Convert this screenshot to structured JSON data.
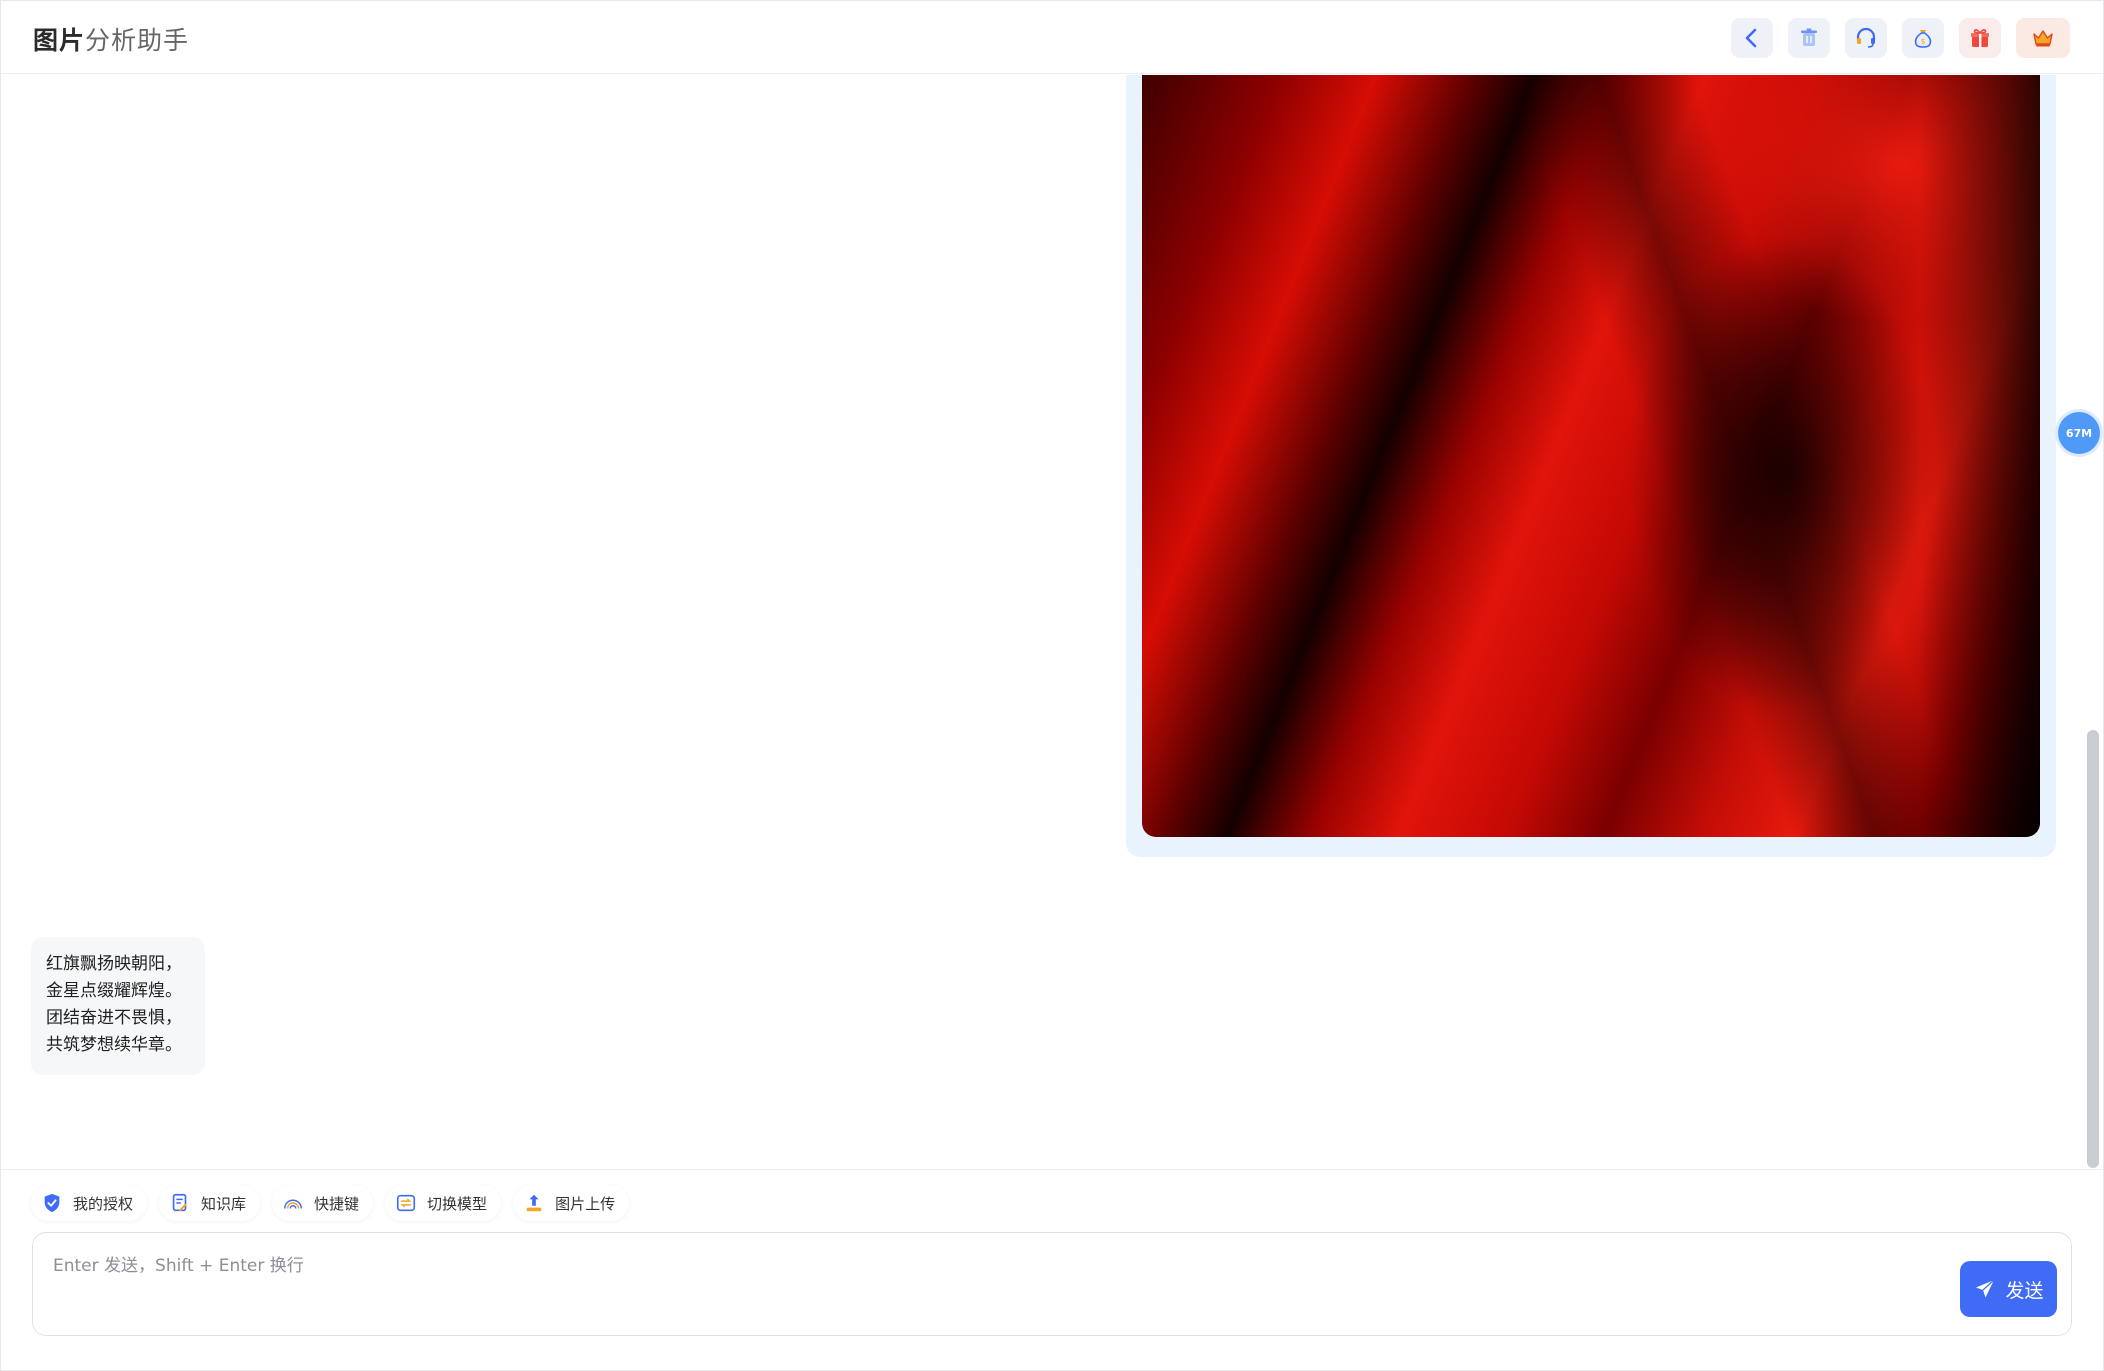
{
  "app": {
    "title_part1": "图片",
    "title_part2": "分析助手"
  },
  "header": {
    "buttons": [
      "back-icon",
      "trash-icon",
      "headset-icon",
      "money-bag-icon",
      "gift-icon",
      "crown-icon"
    ]
  },
  "colors": {
    "accent": "#3f6bf5",
    "bubble_bg": "#e9f3fe",
    "badge": "#4f9af7"
  },
  "messages": {
    "assistant_poem": [
      "红旗飘扬映朝阳，",
      "金星点缀耀辉煌。",
      "团结奋进不畏惧，",
      "共筑梦想续华章。"
    ]
  },
  "memory_badge": "67M",
  "toolbar": {
    "items": [
      {
        "label": "我的授权",
        "icon": "shield-check-icon"
      },
      {
        "label": "知识库",
        "icon": "document-icon"
      },
      {
        "label": "快捷键",
        "icon": "rainbow-icon"
      },
      {
        "label": "切换模型",
        "icon": "switch-icon"
      },
      {
        "label": "图片上传",
        "icon": "upload-icon"
      }
    ]
  },
  "input": {
    "placeholder": "Enter 发送，Shift + Enter 换行",
    "value": ""
  },
  "send_button": {
    "label": "发送"
  }
}
